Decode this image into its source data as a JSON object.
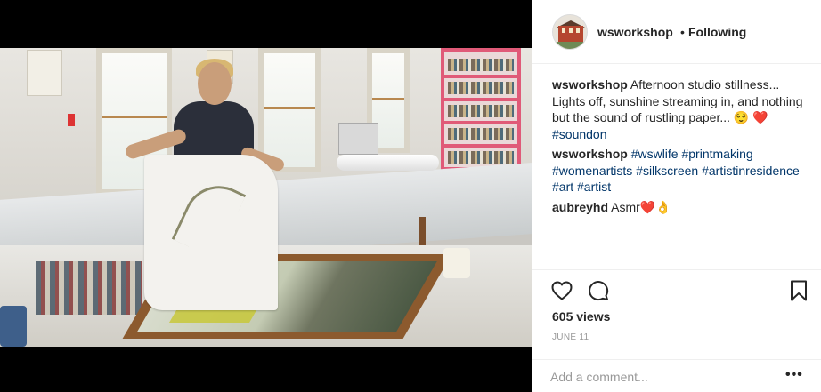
{
  "header": {
    "username": "wsworkshop",
    "separator": "•",
    "follow_status": "Following"
  },
  "comments": [
    {
      "user": "wsworkshop",
      "text": "Afternoon studio stillness... Lights off, sunshine streaming in, and nothing but the sound of rustling paper...",
      "emoji": "😌",
      "heart": "❤️",
      "tags": [
        "#soundon"
      ]
    },
    {
      "user": "wsworkshop",
      "tags": [
        "#wswlife",
        "#printmaking",
        "#womenartists",
        "#silkscreen",
        "#artistinresidence",
        "#art",
        "#artist"
      ]
    },
    {
      "user": "aubreyhd",
      "text": "Asmr",
      "heart": "❤️",
      "emoji": "👌"
    }
  ],
  "stats": {
    "views": "605 views",
    "date": "JUNE 11"
  },
  "add_comment": {
    "placeholder": "Add a comment...",
    "more_label": "•••"
  },
  "icons": {
    "like": "heart-outline-icon",
    "comment": "speech-bubble-icon",
    "save": "bookmark-icon"
  },
  "colors": {
    "hashtag": "#003569",
    "heart": "#e0245e",
    "muted": "#999999"
  }
}
